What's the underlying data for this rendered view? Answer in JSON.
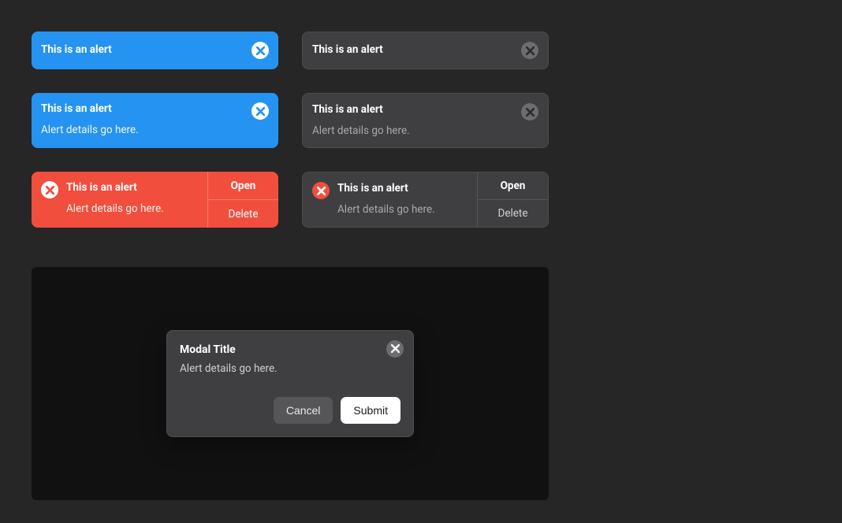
{
  "alerts": {
    "info_simple": {
      "title": "This is an alert"
    },
    "neutral_simple": {
      "title": "This is an alert"
    },
    "info_detail": {
      "title": "This is an alert",
      "desc": "Alert details go here."
    },
    "neutral_detail": {
      "title": "This is an alert",
      "desc": "Alert details go here."
    },
    "danger_actions": {
      "title": "This is an alert",
      "desc": "Alert details go here.",
      "action_primary": "Open",
      "action_secondary": "Delete"
    },
    "neutral_danger_actions": {
      "title": "This is an alert",
      "desc": "Alert details go here.",
      "action_primary": "Open",
      "action_secondary": "Delete"
    }
  },
  "modal": {
    "title": "Modal Title",
    "desc": "Alert details go here.",
    "cancel": "Cancel",
    "submit": "Submit"
  }
}
